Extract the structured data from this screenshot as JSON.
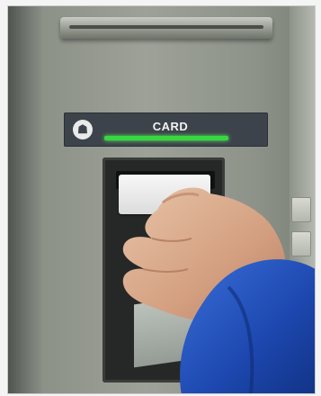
{
  "panel": {
    "label": "CARD",
    "indicator_color": "#38d63f"
  },
  "icons": {
    "panel_logo": "bank-logo-icon"
  }
}
